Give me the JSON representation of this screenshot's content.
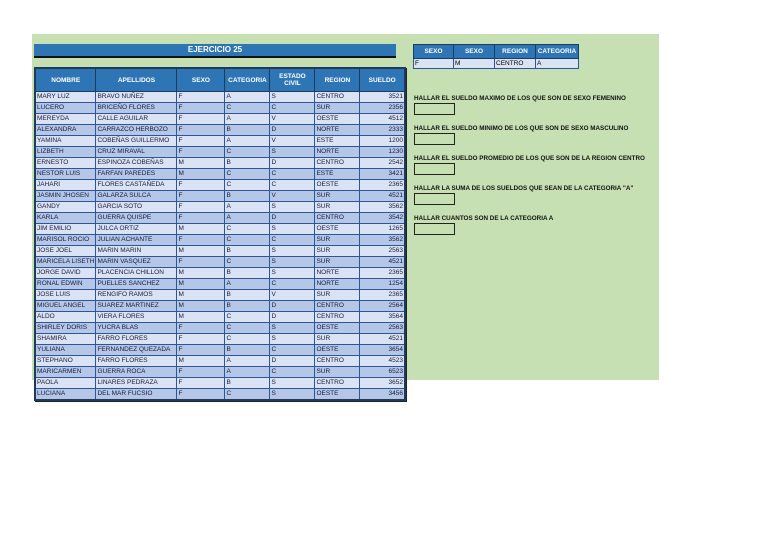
{
  "title": "EJERCICIO 25",
  "columns": [
    "NOMBRE",
    "APELLIDOS",
    "SEXO",
    "CATEGORIA",
    "ESTADO CIVIL",
    "REGION",
    "SUELDO"
  ],
  "rows": [
    [
      "MARY LUZ",
      "BRAVO NUÑEZ",
      "F",
      "A",
      "S",
      "CENTRO",
      "3521"
    ],
    [
      "LUCERO",
      "BRICEÑO FLORES",
      "F",
      "C",
      "C",
      "SUR",
      "2356"
    ],
    [
      "MEREYDA",
      "CALLE AGUILAR",
      "F",
      "A",
      "V",
      "OESTE",
      "4512"
    ],
    [
      "ALEXANDRA",
      "CARRAZCO HERBOZO",
      "F",
      "B",
      "D",
      "NORTE",
      "2333"
    ],
    [
      "YAMINA",
      "COBEÑAS GUILLERMO",
      "F",
      "A",
      "V",
      "ESTE",
      "1200"
    ],
    [
      "LIZBETH",
      "CRUZ MIRAVAL",
      "F",
      "C",
      "S",
      "NORTE",
      "1230"
    ],
    [
      "ERNESTO",
      "ESPINOZA COBEÑAS",
      "M",
      "B",
      "D",
      "CENTRO",
      "2542"
    ],
    [
      "NESTOR LUIS",
      "FARFAN PAREDES",
      "M",
      "C",
      "C",
      "ESTE",
      "3421"
    ],
    [
      "JAHARI",
      "FLORES CASTAÑEDA",
      "F",
      "C",
      "C",
      "OESTE",
      "2365"
    ],
    [
      "JASMIN JHOSEN",
      "GALARZA SULCA",
      "F",
      "B",
      "V",
      "SUR",
      "4521"
    ],
    [
      "GANDY",
      "GARCIA SOTO",
      "F",
      "A",
      "S",
      "SUR",
      "3562"
    ],
    [
      "KARLA",
      "GUERRA QUISPE",
      "F",
      "A",
      "D",
      "CENTRO",
      "3542"
    ],
    [
      "JIM EMILIO",
      "JULCA ORTIZ",
      "M",
      "C",
      "S",
      "OESTE",
      "1265"
    ],
    [
      "MARISOL ROCIO",
      "JULIAN ACHANTE",
      "F",
      "C",
      "C",
      "SUR",
      "3562"
    ],
    [
      "JOSE JOEL",
      "MARIN MARIN",
      "M",
      "B",
      "S",
      "SUR",
      "2563"
    ],
    [
      "MARICELA LISETH",
      "MARIN VASQUEZ",
      "F",
      "C",
      "S",
      "SUR",
      "4521"
    ],
    [
      "JORGE DAVID",
      "PLACENCIA CHILLON",
      "M",
      "B",
      "S",
      "NORTE",
      "2365"
    ],
    [
      "RONAL EDWIN",
      "PUELLES SANCHEZ",
      "M",
      "A",
      "C",
      "NORTE",
      "1254"
    ],
    [
      "JOSE LUIS",
      "RENGIFO RAMOS",
      "M",
      "B",
      "V",
      "SUR",
      "2365"
    ],
    [
      "MIGUEL ANGEL",
      "SUAREZ MARTINEZ",
      "M",
      "B",
      "D",
      "CENTRO",
      "2564"
    ],
    [
      "ALDO",
      "VIERA FLORES",
      "M",
      "C",
      "D",
      "CENTRO",
      "3564"
    ],
    [
      "SHIRLEY DORIS",
      "YUCRA BLAS",
      "F",
      "C",
      "S",
      "OESTE",
      "2563"
    ],
    [
      "SHAMIRA",
      "FARRO FLORES",
      "F",
      "C",
      "S",
      "SUR",
      "4521"
    ],
    [
      "YULIANA",
      "FERNANDEZ QUEZADA",
      "F",
      "B",
      "C",
      "OESTE",
      "3654"
    ],
    [
      "STEPHANO",
      "FARRO FLORES",
      "M",
      "A",
      "D",
      "CENTRO",
      "4523"
    ],
    [
      "MARICARMEN",
      "GUERRA ROCA",
      "F",
      "A",
      "C",
      "SUR",
      "6523"
    ],
    [
      "PAOLA",
      "LINARES PEDRAZA",
      "F",
      "B",
      "S",
      "CENTRO",
      "3652"
    ],
    [
      "LUCIANA",
      "DEL MAR FUCSIO",
      "F",
      "C",
      "S",
      "OESTE",
      "3456"
    ]
  ],
  "criteria": {
    "headers": [
      "SEXO",
      "SEXO",
      "REGION",
      "CATEGORIA"
    ],
    "values": [
      "F",
      "M",
      "CENTRO",
      "A"
    ]
  },
  "questions": [
    "HALLAR EL SUELDO MAXIMO DE LOS QUE SON DE SEXO FEMENINO",
    "HALLAR EL SUELDO MINIMO DE LOS QUE SON DE SEXO MASCULINO",
    "HALLAR EL SUELDO PROMEDIO DE LOS QUE SON DE LA REGION CENTRO",
    "HALLAR LA SUMA DE LOS SUELDOS QUE SEAN DE LA CATEGORIA \"A\"",
    "HALLAR CUANTOS SON DE LA CATEGORIA A"
  ]
}
